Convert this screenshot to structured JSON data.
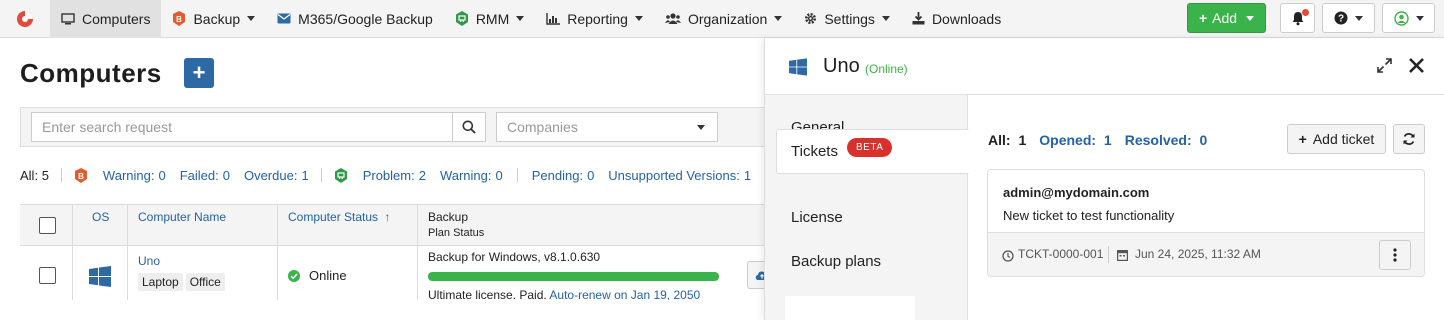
{
  "nav": {
    "items": [
      {
        "label": "Computers",
        "icon": "monitor-icon"
      },
      {
        "label": "Backup",
        "icon": "backup-shield-icon"
      },
      {
        "label": "M365/Google Backup",
        "icon": "envelope-icon"
      },
      {
        "label": "RMM",
        "icon": "rmm-icon"
      },
      {
        "label": "Reporting",
        "icon": "bar-chart-icon"
      },
      {
        "label": "Organization",
        "icon": "users-icon"
      },
      {
        "label": "Settings",
        "icon": "gear-icon"
      },
      {
        "label": "Downloads",
        "icon": "download-icon"
      }
    ],
    "add_label": "Add"
  },
  "page": {
    "title": "Computers",
    "search_placeholder": "Enter search request",
    "companies_placeholder": "Companies"
  },
  "stats": {
    "all_label": "All:",
    "all_value": "5",
    "warning_label": "Warning:",
    "warning_value": "0",
    "failed_label": "Failed:",
    "failed_value": "0",
    "overdue_label": "Overdue:",
    "overdue_value": "1",
    "problem_label": "Problem:",
    "problem_value": "2",
    "rmm_warning_label": "Warning:",
    "rmm_warning_value": "0",
    "pending_label": "Pending:",
    "pending_value": "0",
    "unsupported_label": "Unsupported Versions:",
    "unsupported_value": "1"
  },
  "grid": {
    "headers": {
      "os": "OS",
      "name": "Computer Name",
      "status": "Computer Status",
      "backup": "Backup",
      "plan_status": "Plan Status"
    },
    "rows": [
      {
        "name": "Uno",
        "tags": [
          "Laptop",
          "Office"
        ],
        "status": "Online",
        "backup_version": "Backup for Windows, v8.1.0.630",
        "backup_progress": 1.0,
        "license_text": "Ultimate license. Paid.",
        "renew_link": "Auto-renew on Jan 19, 2050"
      }
    ]
  },
  "panel": {
    "computer_name": "Uno",
    "status": "(Online)",
    "tabs": {
      "general": "General",
      "tickets": "Tickets",
      "tickets_badge": "BETA",
      "license": "License",
      "backup_plans": "Backup plans"
    },
    "counts": {
      "all_label": "All:",
      "all_value": "1",
      "opened_label": "Opened:",
      "opened_value": "1",
      "resolved_label": "Resolved:",
      "resolved_value": "0"
    },
    "add_ticket_label": "Add ticket",
    "ticket": {
      "email": "admin@mydomain.com",
      "message": "New ticket to test functionality",
      "id": "TCKT-0000-001",
      "date": "Jun 24, 2025, 11:32 AM"
    }
  },
  "colors": {
    "brand_red": "#e5493a",
    "green": "#3ab44a",
    "link_blue": "#2462a7",
    "title_button_blue": "#2d6aa5",
    "beta_red": "#d9302c",
    "online_green": "#3ab44a",
    "backup_orange": "#e55b2b",
    "rmm_green": "#2e9a48"
  }
}
